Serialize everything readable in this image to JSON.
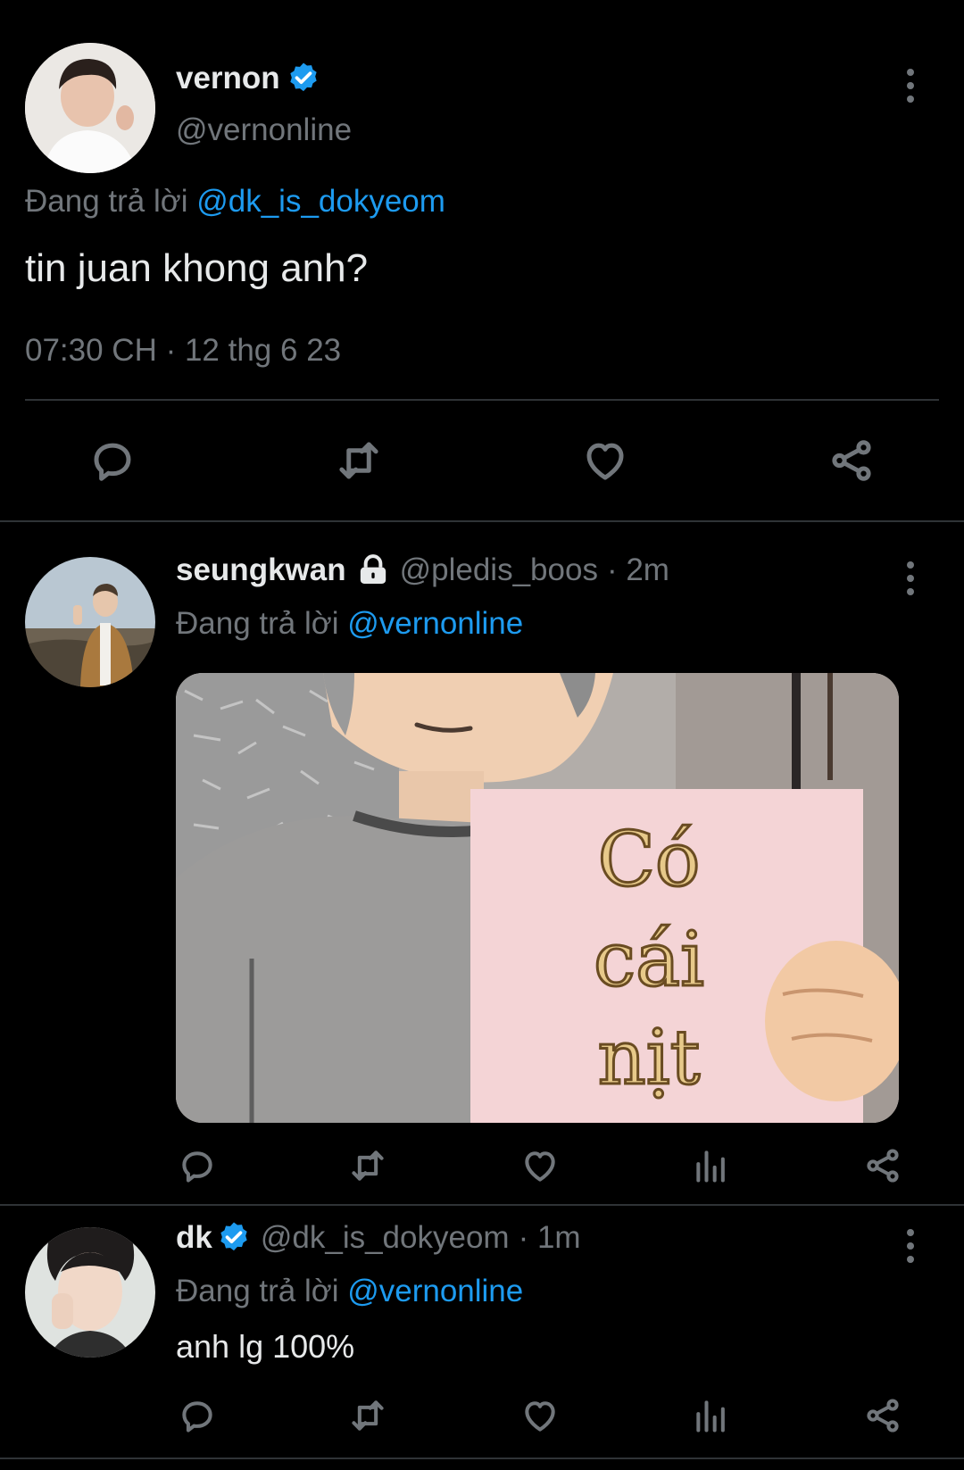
{
  "colors": {
    "background": "#000000",
    "text": "#e7e9ea",
    "muted": "#71767b",
    "link": "#1d9bf0",
    "verified": "#1d9bf0"
  },
  "main_tweet": {
    "display_name": "vernon",
    "handle": "@vernonline",
    "verified": true,
    "replying_prefix": "Đang trả lời",
    "replying_to": "@dk_is_dokyeom",
    "text": "tin juan khong anh?",
    "timestamp": "07:30 CH · 12 thg 6 23",
    "actions": [
      "reply-icon",
      "retweet-icon",
      "like-icon",
      "share-icon"
    ]
  },
  "replies": [
    {
      "display_name": "seungkwan",
      "locked": true,
      "handle": "@pledis_boos",
      "time": "· 2m",
      "replying_prefix": "Đang trả lời",
      "replying_to": "@vernonline",
      "media_sign_text": [
        "Có",
        "cái",
        "nịt"
      ],
      "actions": [
        "reply-icon",
        "retweet-icon",
        "like-icon",
        "views-icon",
        "share-icon"
      ]
    },
    {
      "display_name": "dk",
      "verified": true,
      "handle": "@dk_is_dokyeom",
      "time": "· 1m",
      "replying_prefix": "Đang trả lời",
      "replying_to": "@vernonline",
      "text": "anh lg 100%",
      "actions": [
        "reply-icon",
        "retweet-icon",
        "like-icon",
        "views-icon",
        "share-icon"
      ]
    }
  ]
}
